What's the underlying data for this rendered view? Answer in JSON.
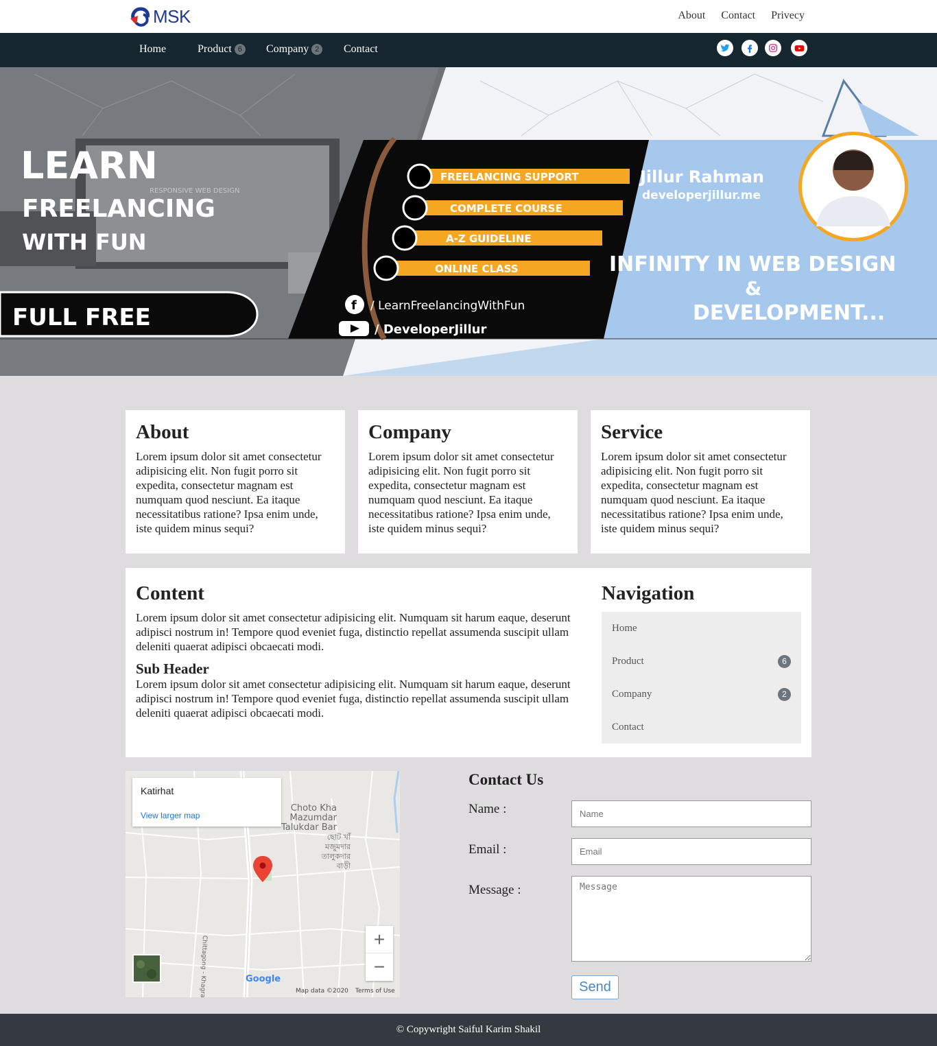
{
  "brand": {
    "logo_text": "MSK"
  },
  "top_links": [
    "About",
    "Contact",
    "Privecy"
  ],
  "nav": {
    "items": [
      {
        "label": "Home",
        "badge": null
      },
      {
        "label": "Product",
        "badge": "6"
      },
      {
        "label": "Company",
        "badge": "2"
      },
      {
        "label": "Contact",
        "badge": null
      }
    ],
    "social": [
      "twitter-icon",
      "facebook-icon",
      "instagram-icon",
      "youtube-icon"
    ]
  },
  "hero": {
    "line1": "LEARN",
    "line2": "FREELANCING",
    "line3": "WITH FUN",
    "full_free": "FULL   FREE",
    "features": [
      "FREELANCING  SUPPORT",
      "COMPLETE  COURSE",
      "A-Z  GUIDELINE",
      "ONLINE  CLASS"
    ],
    "facebook_handle": "/ LearnFreelancingWithFun",
    "youtube_handle": "/ DeveloperJillur",
    "name": "Jillur Rahman",
    "website": "developerjillur.me",
    "tagline1": "INFINITY IN WEB DESIGN",
    "tagline_amp": "&",
    "tagline2": "DEVELOPMENT...",
    "screen_caption": "RESPONSIVE WEB DESIGN"
  },
  "cards": [
    {
      "title": "About",
      "text": "Lorem ipsum dolor sit amet consectetur adipisicing elit. Non fugit porro sit expedita, consectetur magnam est numquam quod nesciunt. Ea itaque necessitatibus ratione? Ipsa enim unde, iste quidem minus sequi?"
    },
    {
      "title": "Company",
      "text": "Lorem ipsum dolor sit amet consectetur adipisicing elit. Non fugit porro sit expedita, consectetur magnam est numquam quod nesciunt. Ea itaque necessitatibus ratione? Ipsa enim unde, iste quidem minus sequi?"
    },
    {
      "title": "Service",
      "text": "Lorem ipsum dolor sit amet consectetur adipisicing elit. Non fugit porro sit expedita, consectetur magnam est numquam quod nesciunt. Ea itaque necessitatibus ratione? Ipsa enim unde, iste quidem minus sequi?"
    }
  ],
  "content": {
    "title": "Content",
    "text": "Lorem ipsum dolor sit amet consectetur adipisicing elit. Numquam sit harum eaque, deserunt adipisci nostrum in! Tempore quod eveniet fuga, distinctio repellat assumenda suscipit ullam deleniti quaerat adipisci obcaecati modi.",
    "sub_header": "Sub Header",
    "sub_text": "Lorem ipsum dolor sit amet consectetur adipisicing elit. Numquam sit harum eaque, deserunt adipisci nostrum in! Tempore quod eveniet fuga, distinctio repellat assumenda suscipit ullam deleniti quaerat adipisci obcaecati modi."
  },
  "side_nav": {
    "title": "Navigation",
    "items": [
      {
        "label": "Home",
        "badge": null
      },
      {
        "label": "Product",
        "badge": "6"
      },
      {
        "label": "Company",
        "badge": "2"
      },
      {
        "label": "Contact",
        "badge": null
      }
    ]
  },
  "map": {
    "place": "Katirhat",
    "larger_map": "View larger map",
    "zoom_in": "+",
    "zoom_out": "−",
    "area_label_en": "Choto Kha\nMazumdar\nTalukdar Bar",
    "area_label_bn": "ছোট খাঁ\nমজুমদার\nতালুকদার\nবাড়ী",
    "road_label": "Chittagong - Khagrachhari Rd",
    "google": "Google",
    "map_data": "Map data ©2020",
    "terms": "Terms of Use"
  },
  "contact": {
    "title": "Contact Us",
    "name_label": "Name :",
    "email_label": "Email :",
    "message_label": "Message :",
    "name_placeholder": "Name",
    "email_placeholder": "Email",
    "message_placeholder": "Message",
    "send": "Send"
  },
  "footer": {
    "text": "© Copywright Saiful Karim Shakil"
  },
  "colors": {
    "nav_bg": "#16262f",
    "footer_bg": "#343a40",
    "page_bg": "#dedcde",
    "hero_orange": "#f5a623",
    "hero_blue": "#a6c8ec"
  }
}
